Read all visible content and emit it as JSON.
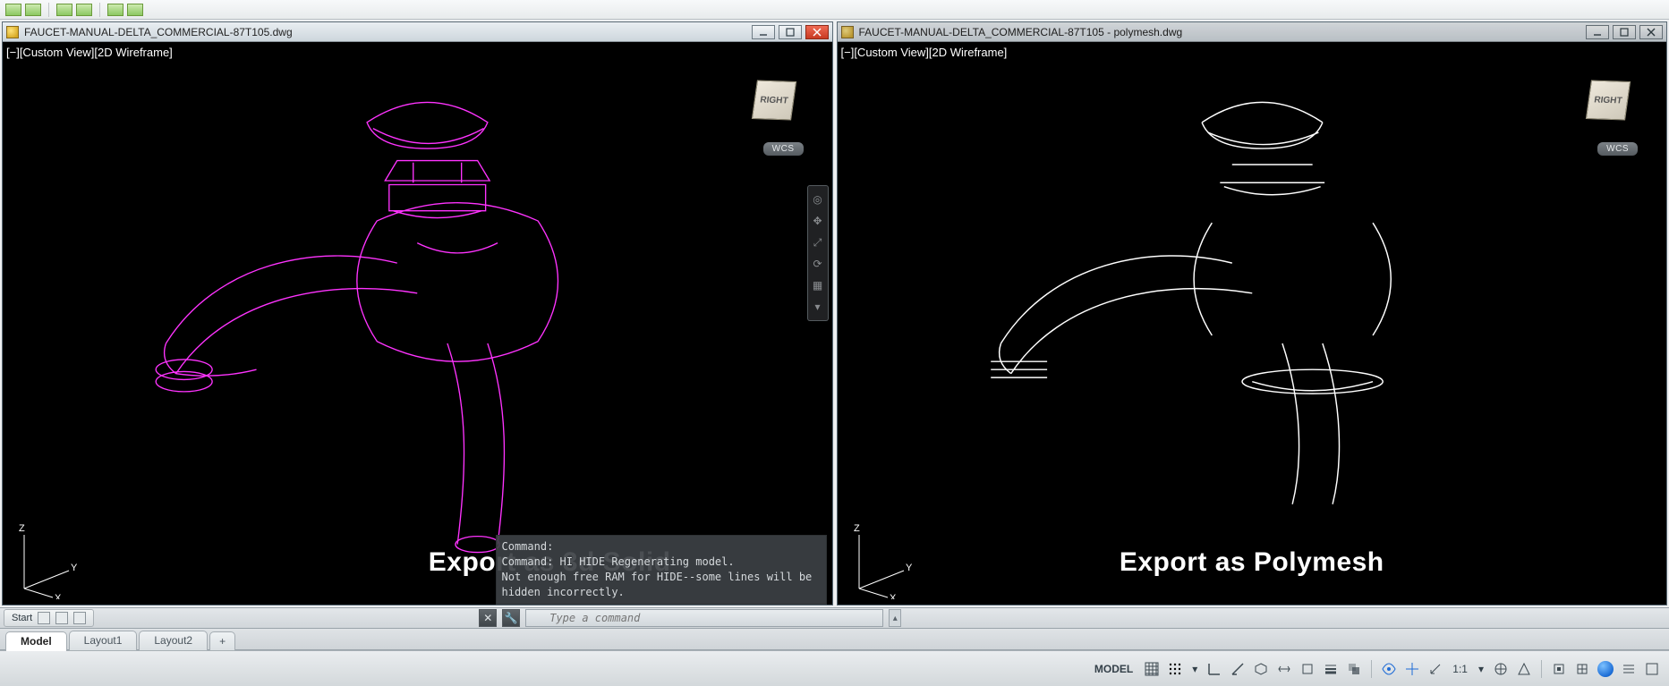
{
  "top_ribbon": {
    "swatch_count": 6
  },
  "windows": {
    "left": {
      "title": "FAUCET-MANUAL-DELTA_COMMERCIAL-87T105.dwg",
      "viewport_label": "[−][Custom View][2D Wireframe]",
      "viewcube_face": "RIGHT",
      "wcs_label": "WCS",
      "annotation": "Export as 3d Solid",
      "drawing_color": "#ff33ff"
    },
    "right": {
      "title": "FAUCET-MANUAL-DELTA_COMMERCIAL-87T105 - polymesh.dwg",
      "viewport_label": "[−][Custom View][2D Wireframe]",
      "viewcube_face": "RIGHT",
      "wcs_label": "WCS",
      "annotation": "Export as Polymesh",
      "drawing_color": "#ffffff"
    }
  },
  "command_history": [
    "Command:",
    "Command: HI HIDE Regenerating model.",
    "Not enough free RAM for HIDE--some lines will be hidden incorrectly."
  ],
  "start_label": "Start",
  "command_prompt": {
    "placeholder": "Type a command"
  },
  "layout_tabs": {
    "model": "Model",
    "layout1": "Layout1",
    "layout2": "Layout2",
    "add": "+"
  },
  "ucs": {
    "x": "X",
    "y": "Y",
    "z": "Z"
  },
  "statusbar": {
    "model_label": "MODEL",
    "scale_text": "1:1",
    "person_icon": " "
  },
  "icons": {
    "navbar": [
      "wheel",
      "pan",
      "zoom",
      "orbit",
      "showmotion",
      "expand"
    ]
  }
}
